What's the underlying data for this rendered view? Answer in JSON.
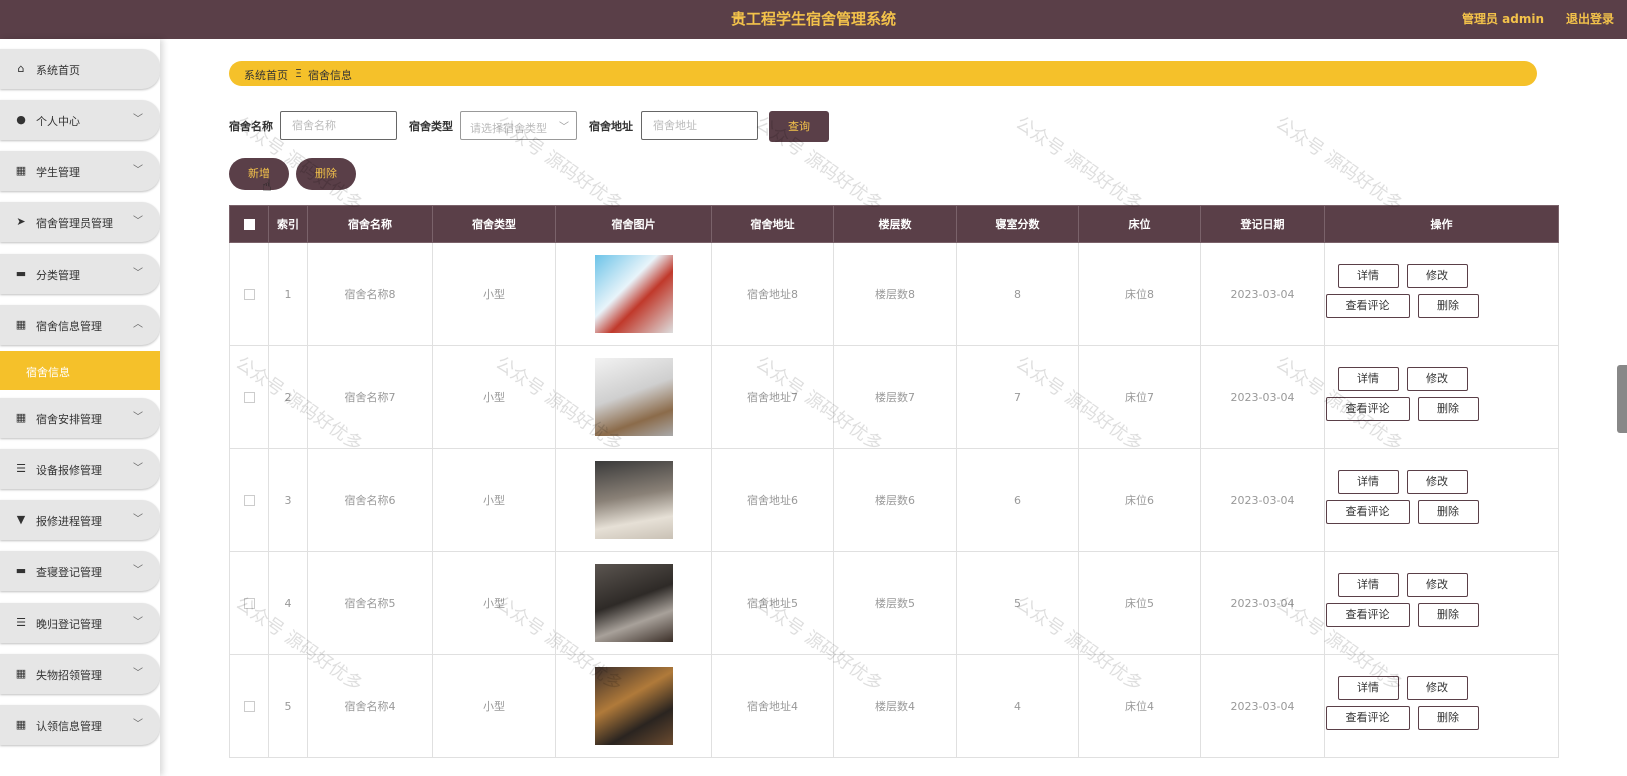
{
  "header": {
    "title": "贵工程学生宿舍管理系统",
    "admin_label": "管理员 admin",
    "logout_label": "退出登录"
  },
  "sidebar": {
    "items": [
      {
        "label": "系统首页",
        "icon": "home-icon",
        "glyph": "⌂",
        "arrow": ""
      },
      {
        "label": "个人中心",
        "icon": "user-icon",
        "glyph": "●",
        "arrow": "﹀"
      },
      {
        "label": "学生管理",
        "icon": "grid-icon",
        "glyph": "▦",
        "arrow": "﹀"
      },
      {
        "label": "宿舍管理员管理",
        "icon": "send-icon",
        "glyph": "➤",
        "arrow": "﹀"
      },
      {
        "label": "分类管理",
        "icon": "briefcase-icon",
        "glyph": "▬",
        "arrow": "﹀"
      },
      {
        "label": "宿舍信息管理",
        "icon": "grid-icon",
        "glyph": "▦",
        "arrow": "︿"
      },
      {
        "label": "宿舍信息",
        "icon": "",
        "glyph": "",
        "arrow": ""
      },
      {
        "label": "宿舍安排管理",
        "icon": "grid-icon",
        "glyph": "▦",
        "arrow": "﹀"
      },
      {
        "label": "设备报修管理",
        "icon": "list-icon",
        "glyph": "☰",
        "arrow": "﹀"
      },
      {
        "label": "报修进程管理",
        "icon": "stamp-icon",
        "glyph": "▼",
        "arrow": "﹀"
      },
      {
        "label": "查寝登记管理",
        "icon": "printer-icon",
        "glyph": "▬",
        "arrow": "﹀"
      },
      {
        "label": "晚归登记管理",
        "icon": "sliders-icon",
        "glyph": "☰",
        "arrow": "﹀"
      },
      {
        "label": "失物招领管理",
        "icon": "grid-icon",
        "glyph": "▦",
        "arrow": "﹀"
      },
      {
        "label": "认领信息管理",
        "icon": "grid-icon",
        "glyph": "▦",
        "arrow": "﹀"
      }
    ]
  },
  "breadcrumb": {
    "home": "系统首页",
    "separator": "Ξ",
    "current": "宿舍信息"
  },
  "search": {
    "name_label": "宿舍名称",
    "name_placeholder": "宿舍名称",
    "type_label": "宿舍类型",
    "type_placeholder": "请选择宿舍类型",
    "address_label": "宿舍地址",
    "address_placeholder": "宿舍地址",
    "query_button": "查询"
  },
  "actions": {
    "add_button": "新增",
    "delete_button": "删除"
  },
  "table": {
    "headers": [
      "索引",
      "宿舍名称",
      "宿舍类型",
      "宿舍图片",
      "宿舍地址",
      "楼层数",
      "寝室分数",
      "床位",
      "登记日期",
      "操作"
    ],
    "rows": [
      {
        "index": "1",
        "name": "宿舍名称8",
        "type": "小型",
        "address": "宿舍地址8",
        "floors": "楼层数8",
        "score": "8",
        "bed": "床位8",
        "date": "2023-03-04"
      },
      {
        "index": "2",
        "name": "宿舍名称7",
        "type": "小型",
        "address": "宿舍地址7",
        "floors": "楼层数7",
        "score": "7",
        "bed": "床位7",
        "date": "2023-03-04"
      },
      {
        "index": "3",
        "name": "宿舍名称6",
        "type": "小型",
        "address": "宿舍地址6",
        "floors": "楼层数6",
        "score": "6",
        "bed": "床位6",
        "date": "2023-03-04"
      },
      {
        "index": "4",
        "name": "宿舍名称5",
        "type": "小型",
        "address": "宿舍地址5",
        "floors": "楼层数5",
        "score": "5",
        "bed": "床位5",
        "date": "2023-03-04"
      },
      {
        "index": "5",
        "name": "宿舍名称4",
        "type": "小型",
        "address": "宿舍地址4",
        "floors": "楼层数4",
        "score": "4",
        "bed": "床位4",
        "date": "2023-03-04"
      }
    ],
    "op_labels": {
      "detail": "详情",
      "edit": "修改",
      "comments": "查看评论",
      "delete": "删除"
    }
  },
  "watermark": "公众号 源码好优多",
  "colors": {
    "primary": "#5a3f48",
    "accent": "#f5c12a",
    "header_text": "#f3c24a"
  }
}
